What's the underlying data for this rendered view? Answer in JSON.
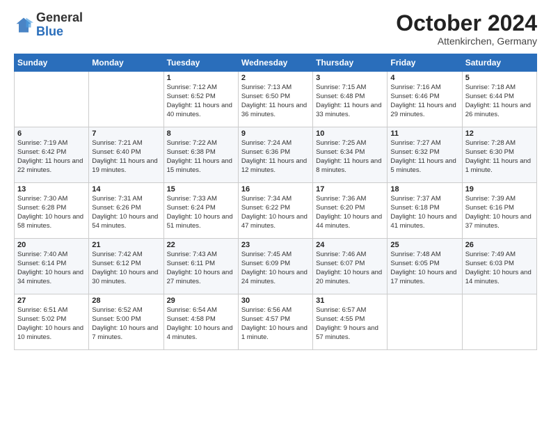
{
  "header": {
    "logo_general": "General",
    "logo_blue": "Blue",
    "month_title": "October 2024",
    "subtitle": "Attenkirchen, Germany"
  },
  "days_of_week": [
    "Sunday",
    "Monday",
    "Tuesday",
    "Wednesday",
    "Thursday",
    "Friday",
    "Saturday"
  ],
  "weeks": [
    [
      {
        "day": "",
        "info": ""
      },
      {
        "day": "",
        "info": ""
      },
      {
        "day": "1",
        "info": "Sunrise: 7:12 AM\nSunset: 6:52 PM\nDaylight: 11 hours and 40 minutes."
      },
      {
        "day": "2",
        "info": "Sunrise: 7:13 AM\nSunset: 6:50 PM\nDaylight: 11 hours and 36 minutes."
      },
      {
        "day": "3",
        "info": "Sunrise: 7:15 AM\nSunset: 6:48 PM\nDaylight: 11 hours and 33 minutes."
      },
      {
        "day": "4",
        "info": "Sunrise: 7:16 AM\nSunset: 6:46 PM\nDaylight: 11 hours and 29 minutes."
      },
      {
        "day": "5",
        "info": "Sunrise: 7:18 AM\nSunset: 6:44 PM\nDaylight: 11 hours and 26 minutes."
      }
    ],
    [
      {
        "day": "6",
        "info": "Sunrise: 7:19 AM\nSunset: 6:42 PM\nDaylight: 11 hours and 22 minutes."
      },
      {
        "day": "7",
        "info": "Sunrise: 7:21 AM\nSunset: 6:40 PM\nDaylight: 11 hours and 19 minutes."
      },
      {
        "day": "8",
        "info": "Sunrise: 7:22 AM\nSunset: 6:38 PM\nDaylight: 11 hours and 15 minutes."
      },
      {
        "day": "9",
        "info": "Sunrise: 7:24 AM\nSunset: 6:36 PM\nDaylight: 11 hours and 12 minutes."
      },
      {
        "day": "10",
        "info": "Sunrise: 7:25 AM\nSunset: 6:34 PM\nDaylight: 11 hours and 8 minutes."
      },
      {
        "day": "11",
        "info": "Sunrise: 7:27 AM\nSunset: 6:32 PM\nDaylight: 11 hours and 5 minutes."
      },
      {
        "day": "12",
        "info": "Sunrise: 7:28 AM\nSunset: 6:30 PM\nDaylight: 11 hours and 1 minute."
      }
    ],
    [
      {
        "day": "13",
        "info": "Sunrise: 7:30 AM\nSunset: 6:28 PM\nDaylight: 10 hours and 58 minutes."
      },
      {
        "day": "14",
        "info": "Sunrise: 7:31 AM\nSunset: 6:26 PM\nDaylight: 10 hours and 54 minutes."
      },
      {
        "day": "15",
        "info": "Sunrise: 7:33 AM\nSunset: 6:24 PM\nDaylight: 10 hours and 51 minutes."
      },
      {
        "day": "16",
        "info": "Sunrise: 7:34 AM\nSunset: 6:22 PM\nDaylight: 10 hours and 47 minutes."
      },
      {
        "day": "17",
        "info": "Sunrise: 7:36 AM\nSunset: 6:20 PM\nDaylight: 10 hours and 44 minutes."
      },
      {
        "day": "18",
        "info": "Sunrise: 7:37 AM\nSunset: 6:18 PM\nDaylight: 10 hours and 41 minutes."
      },
      {
        "day": "19",
        "info": "Sunrise: 7:39 AM\nSunset: 6:16 PM\nDaylight: 10 hours and 37 minutes."
      }
    ],
    [
      {
        "day": "20",
        "info": "Sunrise: 7:40 AM\nSunset: 6:14 PM\nDaylight: 10 hours and 34 minutes."
      },
      {
        "day": "21",
        "info": "Sunrise: 7:42 AM\nSunset: 6:12 PM\nDaylight: 10 hours and 30 minutes."
      },
      {
        "day": "22",
        "info": "Sunrise: 7:43 AM\nSunset: 6:11 PM\nDaylight: 10 hours and 27 minutes."
      },
      {
        "day": "23",
        "info": "Sunrise: 7:45 AM\nSunset: 6:09 PM\nDaylight: 10 hours and 24 minutes."
      },
      {
        "day": "24",
        "info": "Sunrise: 7:46 AM\nSunset: 6:07 PM\nDaylight: 10 hours and 20 minutes."
      },
      {
        "day": "25",
        "info": "Sunrise: 7:48 AM\nSunset: 6:05 PM\nDaylight: 10 hours and 17 minutes."
      },
      {
        "day": "26",
        "info": "Sunrise: 7:49 AM\nSunset: 6:03 PM\nDaylight: 10 hours and 14 minutes."
      }
    ],
    [
      {
        "day": "27",
        "info": "Sunrise: 6:51 AM\nSunset: 5:02 PM\nDaylight: 10 hours and 10 minutes."
      },
      {
        "day": "28",
        "info": "Sunrise: 6:52 AM\nSunset: 5:00 PM\nDaylight: 10 hours and 7 minutes."
      },
      {
        "day": "29",
        "info": "Sunrise: 6:54 AM\nSunset: 4:58 PM\nDaylight: 10 hours and 4 minutes."
      },
      {
        "day": "30",
        "info": "Sunrise: 6:56 AM\nSunset: 4:57 PM\nDaylight: 10 hours and 1 minute."
      },
      {
        "day": "31",
        "info": "Sunrise: 6:57 AM\nSunset: 4:55 PM\nDaylight: 9 hours and 57 minutes."
      },
      {
        "day": "",
        "info": ""
      },
      {
        "day": "",
        "info": ""
      }
    ]
  ]
}
